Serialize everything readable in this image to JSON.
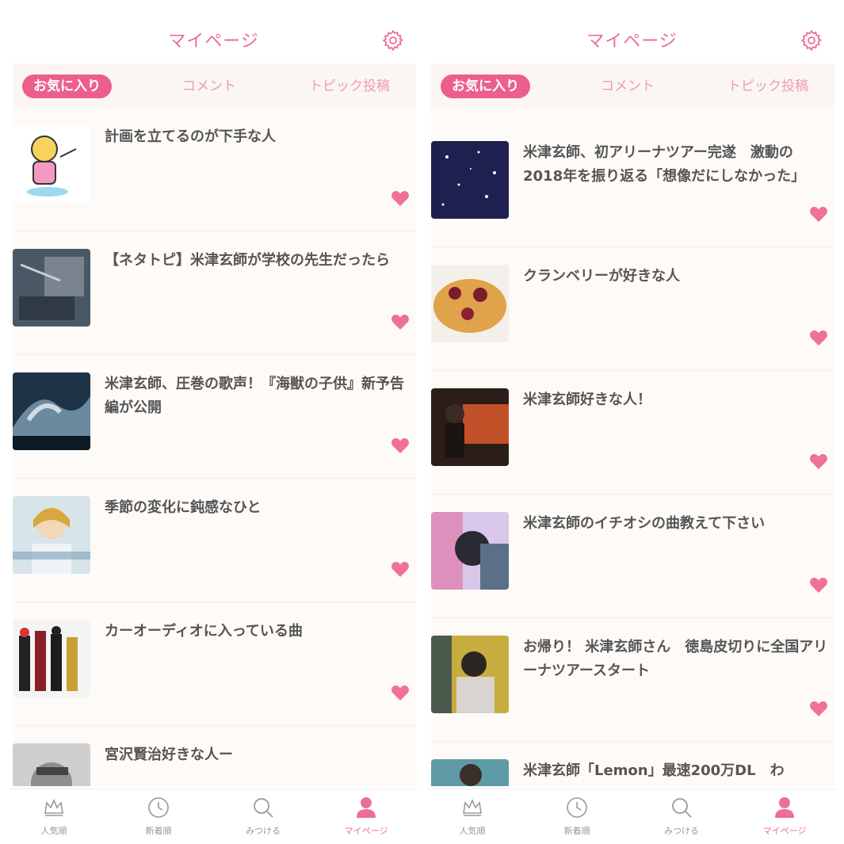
{
  "screens": [
    {
      "header": {
        "title": "マイページ"
      },
      "tabs": [
        "お気に入り",
        "コメント",
        "トピック投稿"
      ],
      "items": [
        {
          "title": "計画を立てるのが下手な人"
        },
        {
          "title": "【ネタトピ】米津玄師が学校の先生だったら"
        },
        {
          "title": "米津玄師、圧巻の歌声！『海獣の子供』新予告編が公開"
        },
        {
          "title": "季節の変化に鈍感なひと"
        },
        {
          "title": "カーオーディオに入っている曲"
        },
        {
          "title": "宮沢賢治好きな人ー"
        }
      ],
      "nav": [
        "人気順",
        "新着順",
        "みつける",
        "マイページ"
      ]
    },
    {
      "header": {
        "title": "マイページ"
      },
      "tabs": [
        "お気に入り",
        "コメント",
        "トピック投稿"
      ],
      "items": [
        {
          "title": "米津玄師、初アリーナツアー完遂　激動の2018年を振り返る「想像だにしなかった」"
        },
        {
          "title": "クランベリーが好きな人"
        },
        {
          "title": "米津玄師好きな人！"
        },
        {
          "title": "米津玄師のイチオシの曲教えて下さい"
        },
        {
          "title": "お帰り！ 米津玄師さん　徳島皮切りに全国アリーナツアースタート"
        },
        {
          "title": "米津玄師「Lemon」最速200万DL　わ"
        }
      ],
      "nav": [
        "人気順",
        "新着順",
        "みつける",
        "マイページ"
      ]
    }
  ],
  "colors": {
    "accent": "#ec5f8c",
    "heart": "#f0709a",
    "listBg": "#fefaf7"
  },
  "icons": [
    "gear-icon",
    "heart-icon",
    "crown-icon",
    "clock-icon",
    "search-icon",
    "person-icon"
  ]
}
